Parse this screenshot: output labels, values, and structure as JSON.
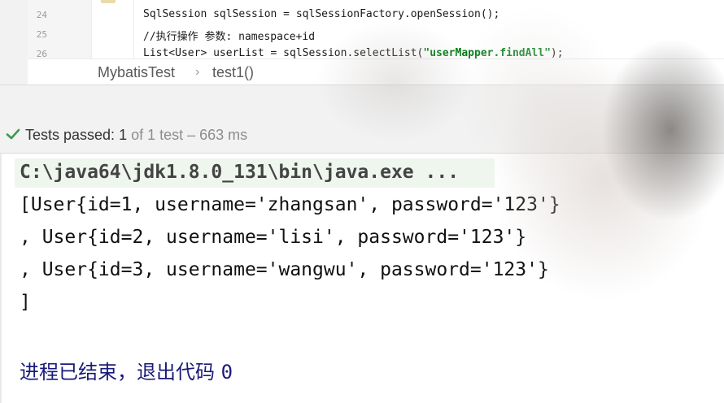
{
  "editor": {
    "lines": [
      {
        "number": "24",
        "text": "SqlSession sqlSession = sqlSessionFactory.openSession();"
      },
      {
        "number": "25",
        "text": "//执行操作 参数: namespace+id"
      },
      {
        "number": "26",
        "text_prefix": "List<User> userList = sqlSession.selectList(",
        "text_string": "\"userMapper.findAll\"",
        "text_suffix": ");"
      }
    ]
  },
  "breadcrumb": {
    "class_name": "MybatisTest",
    "method_name": "test1()"
  },
  "status": {
    "label": "Tests passed: ",
    "passed": "1",
    "summary": " of 1 test – 663 ms",
    "icon": "check-icon",
    "icon_color": "#3d9a4b"
  },
  "console": {
    "command": "C:\\java64\\jdk1.8.0_131\\bin\\java.exe ...",
    "output_lines": [
      "[User{id=1, username='zhangsan', password='123'}",
      ", User{id=2, username='lisi', password='123'}",
      ", User{id=3, username='wangwu', password='123'}",
      "]"
    ],
    "exit_message": "进程已结束，退出代码 ",
    "exit_code": "0"
  }
}
